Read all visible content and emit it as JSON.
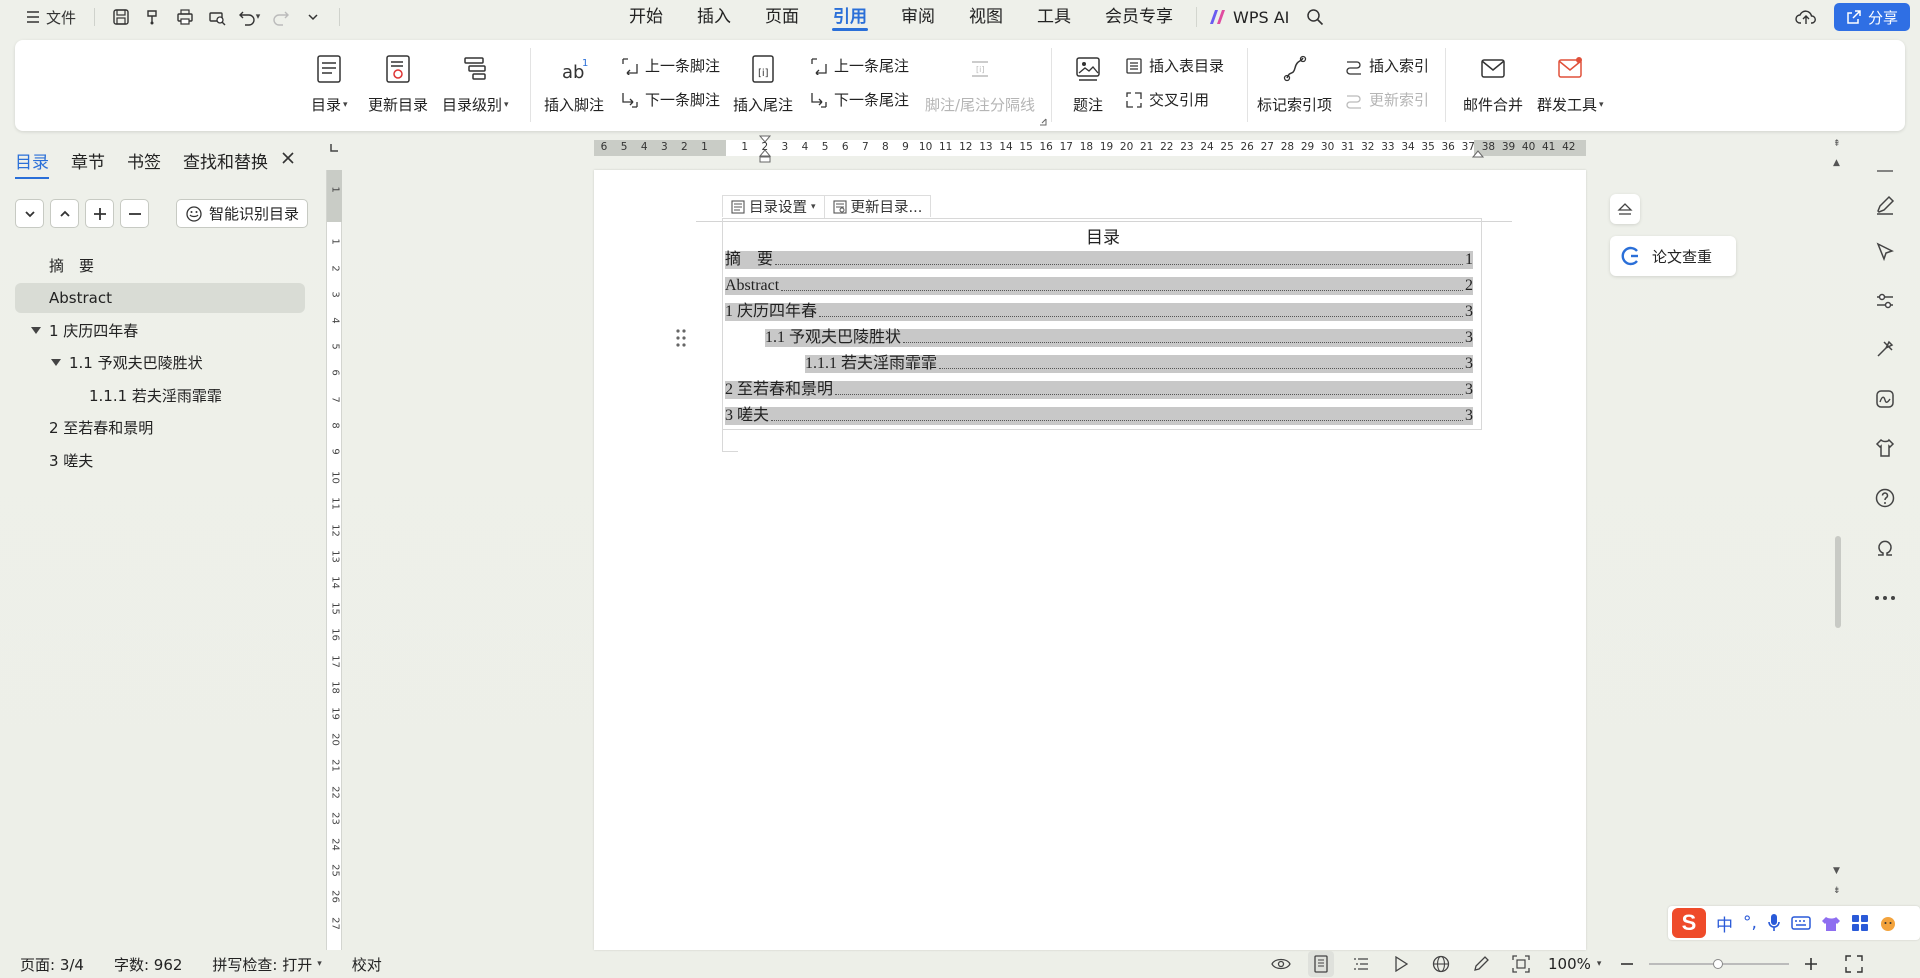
{
  "topbar": {
    "file_label": "文件",
    "tabs": [
      {
        "label": "开始"
      },
      {
        "label": "插入"
      },
      {
        "label": "页面"
      },
      {
        "label": "引用",
        "active": true
      },
      {
        "label": "审阅"
      },
      {
        "label": "视图"
      },
      {
        "label": "工具"
      },
      {
        "label": "会员专享"
      }
    ],
    "ai_label": "WPS AI",
    "share_label": "分享"
  },
  "ribbon": {
    "toc": "目录",
    "update_toc": "更新目录",
    "toc_level": "目录级别",
    "insert_footnote": "插入脚注",
    "prev_footnote": "上一条脚注",
    "next_footnote": "下一条脚注",
    "insert_endnote": "插入尾注",
    "prev_endnote": "上一条尾注",
    "next_endnote": "下一条尾注",
    "footnote_separator": "脚注/尾注分隔线",
    "caption": "题注",
    "insert_table_of_figures": "插入表目录",
    "cross_reference": "交叉引用",
    "mark_index_entry": "标记索引项",
    "insert_index": "插入索引",
    "update_index": "更新索引",
    "mail_merge": "邮件合并",
    "mass_send": "群发工具"
  },
  "left_panel": {
    "tabs": [
      {
        "label": "目录",
        "active": true
      },
      {
        "label": "章节"
      },
      {
        "label": "书签"
      },
      {
        "label": "查找和替换"
      }
    ],
    "smart_toc_label": "智能识别目录",
    "outline": [
      {
        "label": "摘　要",
        "level": 1,
        "has_toggle": false
      },
      {
        "label": "Abstract",
        "level": 1,
        "has_toggle": false,
        "selected": true
      },
      {
        "label": "1 庆历四年春",
        "level": 1,
        "has_toggle": true
      },
      {
        "label": "1.1 予观夫巴陵胜状",
        "level": 2,
        "has_toggle": true
      },
      {
        "label": "1.1.1 若夫淫雨霏霏",
        "level": 3,
        "has_toggle": false
      },
      {
        "label": "2 至若春和景明",
        "level": 1,
        "has_toggle": false
      },
      {
        "label": "3 嗟夫",
        "level": 1,
        "has_toggle": false
      }
    ]
  },
  "ruler": {
    "horizontal_ticks": [
      "6",
      "5",
      "4",
      "3",
      "2",
      "1",
      "",
      "1",
      "2",
      "3",
      "4",
      "5",
      "6",
      "7",
      "8",
      "9",
      "10",
      "11",
      "12",
      "13",
      "14",
      "15",
      "16",
      "17",
      "18",
      "19",
      "20",
      "21",
      "22",
      "23",
      "24",
      "25",
      "26",
      "27",
      "28",
      "29",
      "30",
      "31",
      "32",
      "33",
      "34",
      "35",
      "36",
      "37",
      "38",
      "39",
      "40",
      "41",
      "42"
    ],
    "vertical_ticks": [
      "1",
      "",
      "1",
      "2",
      "3",
      "4",
      "5",
      "6",
      "7",
      "8",
      "9",
      "10",
      "11",
      "12",
      "13",
      "14",
      "15",
      "16",
      "17",
      "18",
      "19",
      "20",
      "21",
      "22",
      "23",
      "24",
      "25",
      "26",
      "27"
    ]
  },
  "document": {
    "toc_toolbar": {
      "settings_label": "目录设置",
      "update_label": "更新目录..."
    },
    "toc_title": "目录",
    "toc_entries": [
      {
        "text": "摘　要",
        "page": "1",
        "level": 1
      },
      {
        "text": "Abstract",
        "page": "2",
        "level": 1
      },
      {
        "text": "1 庆历四年春",
        "page": "3",
        "level": 1
      },
      {
        "text": "1.1 予观夫巴陵胜状",
        "page": "3",
        "level": 2
      },
      {
        "text": "1.1.1 若夫淫雨霏霏",
        "page": "3",
        "level": 3
      },
      {
        "text": "2 至若春和景明",
        "page": "3",
        "level": 1
      },
      {
        "text": "3 嗟夫",
        "page": "3",
        "level": 1
      }
    ]
  },
  "floating": {
    "paper_check_label": "论文查重"
  },
  "ime": {
    "logo": "S",
    "lang": "中"
  },
  "statusbar": {
    "page": "页面: 3/4",
    "word_count": "字数: 962",
    "spell_check": "拼写检查: 打开",
    "proofread": "校对",
    "zoom": "100%"
  },
  "colors": {
    "accent": "#2a6fd8",
    "share_button": "#2f6fe4",
    "toc_highlight": "#c8c8c8",
    "ime_logo": "#ef4b2a"
  }
}
